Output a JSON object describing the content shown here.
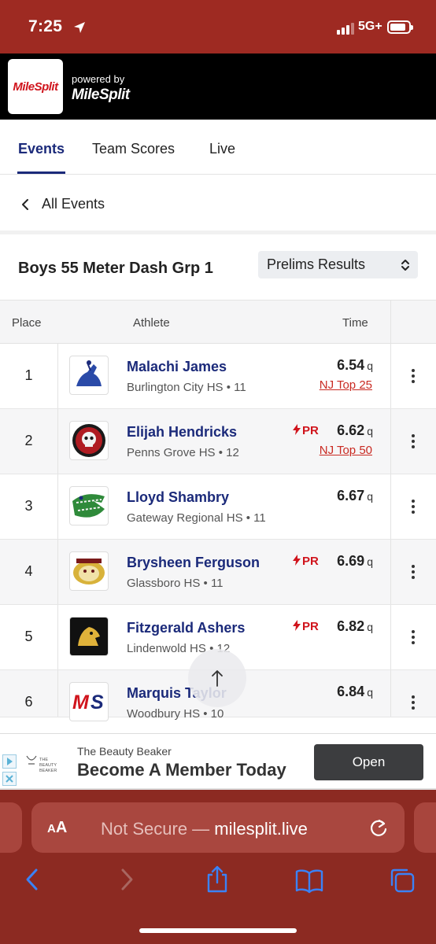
{
  "status_bar": {
    "time": "7:25",
    "network": "5G+",
    "battery_level": 0.85
  },
  "header": {
    "brand_logo_text": "MileSplit",
    "powered_by": "powered by",
    "powered_logo_text": "MileSplit"
  },
  "tabs": [
    {
      "label": "Events",
      "active": true
    },
    {
      "label": "Team Scores",
      "active": false
    },
    {
      "label": "Live",
      "active": false
    }
  ],
  "back_link": {
    "label": "All Events"
  },
  "event": {
    "title": "Boys 55 Meter Dash Grp 1",
    "round_selected": "Prelims Results"
  },
  "table": {
    "headers": {
      "place": "Place",
      "athlete": "Athlete",
      "time": "Time"
    },
    "rows": [
      {
        "place": "1",
        "name": "Malachi James",
        "school": "Burlington City HS • 11",
        "pr": "",
        "mark": "6.54",
        "qualifier": "q",
        "rank_link": "NJ Top 25"
      },
      {
        "place": "2",
        "name": "Elijah Hendricks",
        "school": "Penns Grove HS • 12",
        "pr": "PR",
        "mark": "6.62",
        "qualifier": "q",
        "rank_link": "NJ Top 50"
      },
      {
        "place": "3",
        "name": "Lloyd Shambry",
        "school": "Gateway Regional HS • 11",
        "pr": "",
        "mark": "6.67",
        "qualifier": "q",
        "rank_link": ""
      },
      {
        "place": "4",
        "name": "Brysheen Ferguson",
        "school": "Glassboro HS • 11",
        "pr": "PR",
        "mark": "6.69",
        "qualifier": "q",
        "rank_link": ""
      },
      {
        "place": "5",
        "name": "Fitzgerald Ashers",
        "school": "Lindenwold HS • 12",
        "pr": "PR",
        "mark": "6.82",
        "qualifier": "q",
        "rank_link": ""
      },
      {
        "place": "6",
        "name": "Marquis Taylor",
        "school": "Woodbury HS • 10",
        "pr": "",
        "mark": "6.84",
        "qualifier": "q",
        "rank_link": ""
      }
    ]
  },
  "team_logos": [
    "knight-horse-logo",
    "red-skull-shield-logo",
    "green-gator-logo",
    "gold-bulldog-logo",
    "gold-lion-logo",
    "ms-letters-logo"
  ],
  "ad": {
    "brand": "The Beauty Beaker",
    "headline": "Become A Member Today",
    "cta": "Open",
    "logo_text": "THE BEAUTY BEAKER"
  },
  "browser": {
    "aa_big": "A",
    "aa_small": "A",
    "security": "Not Secure —",
    "domain": "milesplit.live"
  },
  "colors": {
    "accent_navy": "#1b2a7a",
    "brand_red": "#d0141c",
    "browser_chrome": "#8c2a22",
    "link_blue": "#3a82f7"
  }
}
